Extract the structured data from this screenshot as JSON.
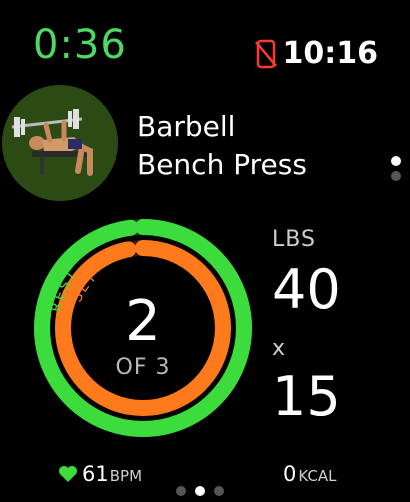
{
  "workout": {
    "elapsed_time": "0:36"
  },
  "status_bar": {
    "time": "10:16",
    "phone_icon": "phone-disconnected-icon",
    "phone_icon_color": "#ff3b30"
  },
  "exercise": {
    "name_line1": "Barbell",
    "name_line2": "Bench Press",
    "image_icon": "bench-press-figure-icon"
  },
  "rings": {
    "rest_label": "REST",
    "set_label": "SET",
    "rest_color": "#3ddc3d",
    "set_color": "#ff7a1c",
    "rest_progress": 0.98,
    "set_progress": 0.97
  },
  "set": {
    "current": "2",
    "of_label": "OF 3"
  },
  "weight": {
    "unit": "LBS",
    "value": "40",
    "times": "x",
    "reps": "15"
  },
  "footer": {
    "heart_rate": "61",
    "heart_rate_unit": "BPM",
    "heart_icon": "heart-icon",
    "calories": "0",
    "calories_unit": "KCAL"
  },
  "pages": {
    "horizontal_count": 3,
    "horizontal_active": 1,
    "vertical_count": 2,
    "vertical_active": 0
  }
}
